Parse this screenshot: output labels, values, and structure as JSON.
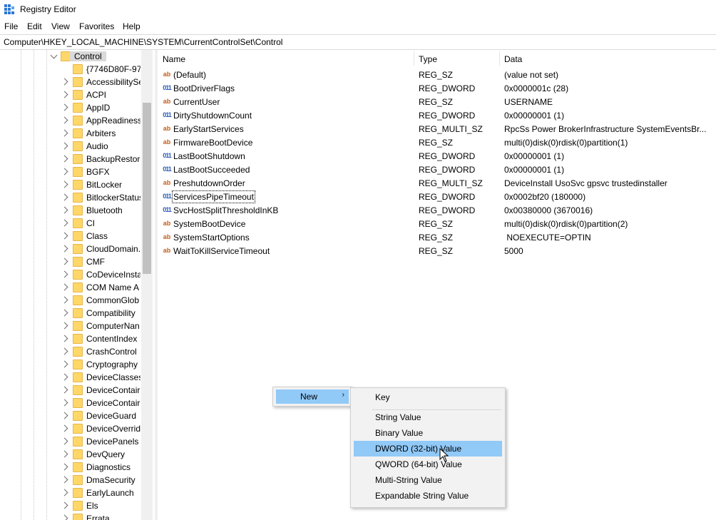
{
  "window": {
    "title": "Registry Editor",
    "icon": "registry-editor-icon"
  },
  "menubar": [
    "File",
    "Edit",
    "View",
    "Favorites",
    "Help"
  ],
  "address": "Computer\\HKEY_LOCAL_MACHINE\\SYSTEM\\CurrentControlSet\\Control",
  "tree": {
    "selected": "Control",
    "children": [
      "{7746D80F-97E",
      "AccessibilitySe",
      "ACPI",
      "AppID",
      "AppReadiness",
      "Arbiters",
      "Audio",
      "BackupRestore",
      "BGFX",
      "BitLocker",
      "BitlockerStatus",
      "Bluetooth",
      "CI",
      "Class",
      "CloudDomain.",
      "CMF",
      "CoDeviceInsta",
      "COM Name A",
      "CommonGlob",
      "Compatibility",
      "ComputerNan",
      "ContentIndex",
      "CrashControl",
      "Cryptography",
      "DeviceClasses",
      "DeviceContair",
      "DeviceContair",
      "DeviceGuard",
      "DeviceOverrid",
      "DevicePanels",
      "DevQuery",
      "Diagnostics",
      "DmaSecurity",
      "EarlyLaunch",
      "Els",
      "Errata"
    ]
  },
  "list": {
    "columns": [
      "Name",
      "Type",
      "Data"
    ],
    "rows": [
      {
        "name": "(Default)",
        "type": "REG_SZ",
        "data": "(value not set)",
        "icon": "ab"
      },
      {
        "name": "BootDriverFlags",
        "type": "REG_DWORD",
        "data": "0x0000001c (28)",
        "icon": "bin"
      },
      {
        "name": "CurrentUser",
        "type": "REG_SZ",
        "data": "USERNAME",
        "icon": "ab"
      },
      {
        "name": "DirtyShutdownCount",
        "type": "REG_DWORD",
        "data": "0x00000001 (1)",
        "icon": "bin"
      },
      {
        "name": "EarlyStartServices",
        "type": "REG_MULTI_SZ",
        "data": "RpcSs Power BrokerInfrastructure SystemEventsBr...",
        "icon": "ab"
      },
      {
        "name": "FirmwareBootDevice",
        "type": "REG_SZ",
        "data": "multi(0)disk(0)rdisk(0)partition(1)",
        "icon": "ab"
      },
      {
        "name": "LastBootShutdown",
        "type": "REG_DWORD",
        "data": "0x00000001 (1)",
        "icon": "bin"
      },
      {
        "name": "LastBootSucceeded",
        "type": "REG_DWORD",
        "data": "0x00000001 (1)",
        "icon": "bin"
      },
      {
        "name": "PreshutdownOrder",
        "type": "REG_MULTI_SZ",
        "data": "DeviceInstall UsoSvc gpsvc trustedinstaller",
        "icon": "ab"
      },
      {
        "name": "ServicesPipeTimeout",
        "type": "REG_DWORD",
        "data": "0x0002bf20 (180000)",
        "icon": "bin"
      },
      {
        "name": "SvcHostSplitThresholdInKB",
        "type": "REG_DWORD",
        "data": "0x00380000 (3670016)",
        "icon": "bin"
      },
      {
        "name": "SystemBootDevice",
        "type": "REG_SZ",
        "data": "multi(0)disk(0)rdisk(0)partition(2)",
        "icon": "ab"
      },
      {
        "name": "SystemStartOptions",
        "type": "REG_SZ",
        "data": " NOEXECUTE=OPTIN",
        "icon": "ab"
      },
      {
        "name": "WaitToKillServiceTimeout",
        "type": "REG_SZ",
        "data": "5000",
        "icon": "ab"
      }
    ]
  },
  "context_menu": {
    "new_label": "New",
    "arrow": "›",
    "submenu": [
      "Key",
      "String Value",
      "Binary Value",
      "DWORD (32-bit) Value",
      "QWORD (64-bit) Value",
      "Multi-String Value",
      "Expandable String Value"
    ],
    "highlighted": "DWORD (32-bit) Value"
  },
  "icon_glyphs": {
    "ab": "ab",
    "bin": "011"
  },
  "colors": {
    "selection": "#91c9f7",
    "tree_selected": "#d9d9d9",
    "folder": "#ffd768"
  }
}
